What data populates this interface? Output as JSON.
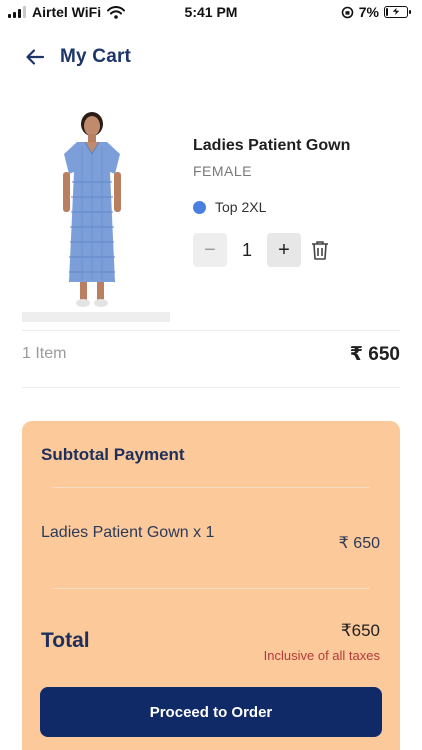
{
  "status_bar": {
    "carrier": "Airtel WiFi",
    "time": "5:41 PM",
    "battery_percent": "7%",
    "battery_level": 0.07
  },
  "header": {
    "title": "My Cart",
    "back_icon": "arrow-left-icon"
  },
  "cart_item": {
    "name": "Ladies Patient Gown",
    "gender": "FEMALE",
    "variant": "Top 2XL",
    "variant_color": "#4a7fe0",
    "quantity": "1",
    "minus_label": "−",
    "plus_label": "+",
    "delete_icon": "trash-icon"
  },
  "cart_summary": {
    "items_count": "1 Item",
    "items_total": "₹ 650"
  },
  "payment": {
    "title": "Subtotal Payment",
    "line_item_name": "Ladies Patient Gown x 1",
    "line_item_price": "₹ 650",
    "total_label": "Total",
    "total_amount": "₹650",
    "tax_note": "Inclusive of all taxes",
    "proceed_label": "Proceed to Order",
    "accent_color": "#fbc99a",
    "button_color": "#0f2a67"
  }
}
